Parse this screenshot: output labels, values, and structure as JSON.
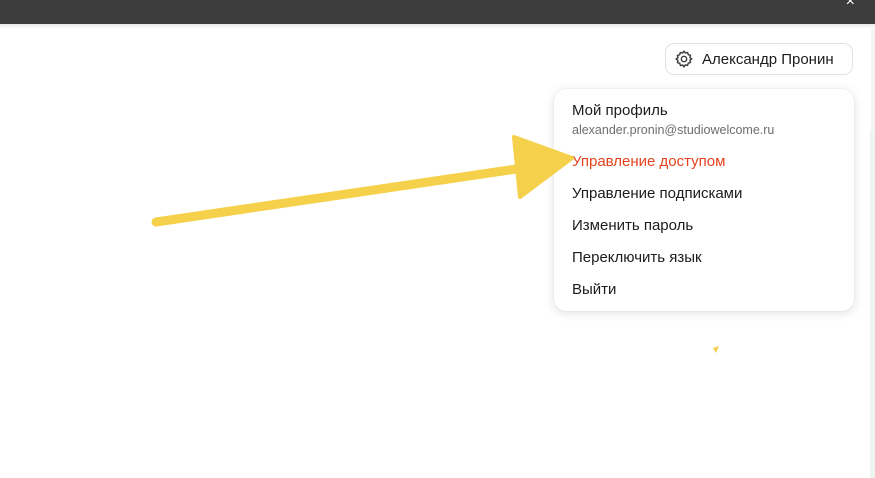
{
  "window": {
    "close_glyph": "×"
  },
  "user_button": {
    "icon": "gear-icon",
    "name": "Александр Пронин"
  },
  "menu": {
    "profile_label": "Мой профиль",
    "email": "alexander.pronin@studiowelcome.ru",
    "items": [
      {
        "label": "Управление доступом",
        "active": true
      },
      {
        "label": "Управление подписками",
        "active": false
      },
      {
        "label": "Изменить пароль",
        "active": false
      },
      {
        "label": "Переключить язык",
        "active": false
      },
      {
        "label": "Выйти",
        "active": false
      }
    ]
  },
  "colors": {
    "topbar": "#3d3d3d",
    "active_item": "#e4431e",
    "arrow": "#f5d04a"
  }
}
